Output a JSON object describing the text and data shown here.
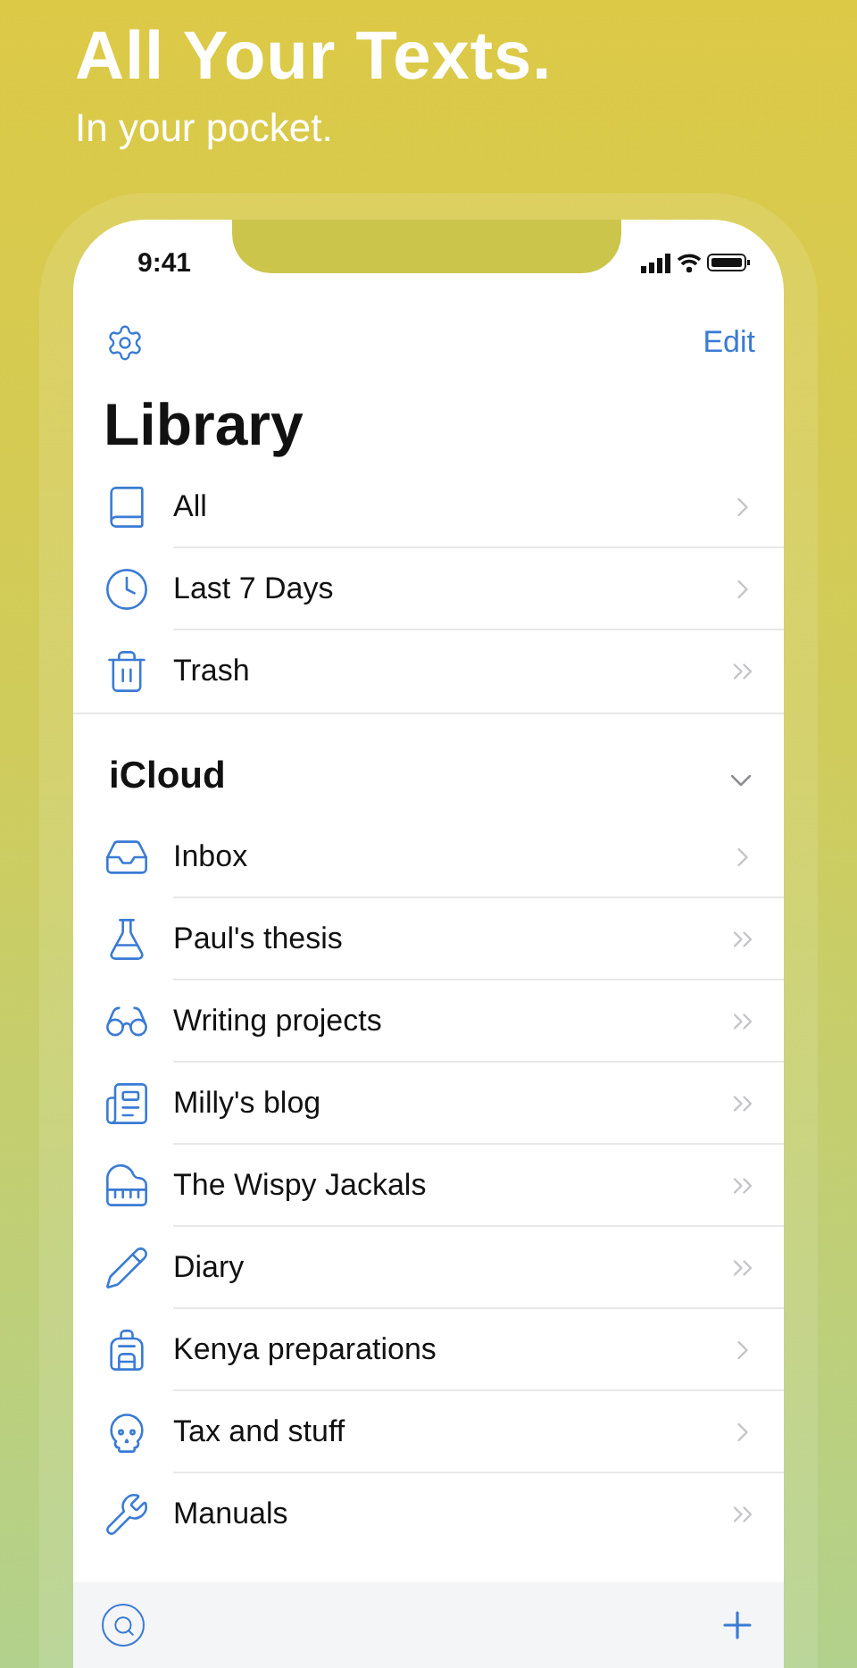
{
  "headline": {
    "title": "All Your Texts.",
    "subtitle": "In your pocket."
  },
  "status_bar": {
    "time": "9:41"
  },
  "nav": {
    "edit": "Edit"
  },
  "title": "Library",
  "library_items": [
    {
      "label": "All",
      "kind": "leaf"
    },
    {
      "label": "Last 7 Days",
      "kind": "leaf"
    },
    {
      "label": "Trash",
      "kind": "nested"
    }
  ],
  "sections": [
    {
      "title": "iCloud",
      "expanded": true,
      "items": [
        {
          "label": "Inbox",
          "kind": "leaf"
        },
        {
          "label": "Paul's thesis",
          "kind": "nested"
        },
        {
          "label": "Writing projects",
          "kind": "nested"
        },
        {
          "label": "Milly's blog",
          "kind": "nested"
        },
        {
          "label": "The Wispy Jackals",
          "kind": "nested"
        },
        {
          "label": "Diary",
          "kind": "nested"
        },
        {
          "label": "Kenya preparations",
          "kind": "leaf"
        },
        {
          "label": "Tax and stuff",
          "kind": "leaf"
        },
        {
          "label": "Manuals",
          "kind": "nested"
        }
      ]
    }
  ]
}
